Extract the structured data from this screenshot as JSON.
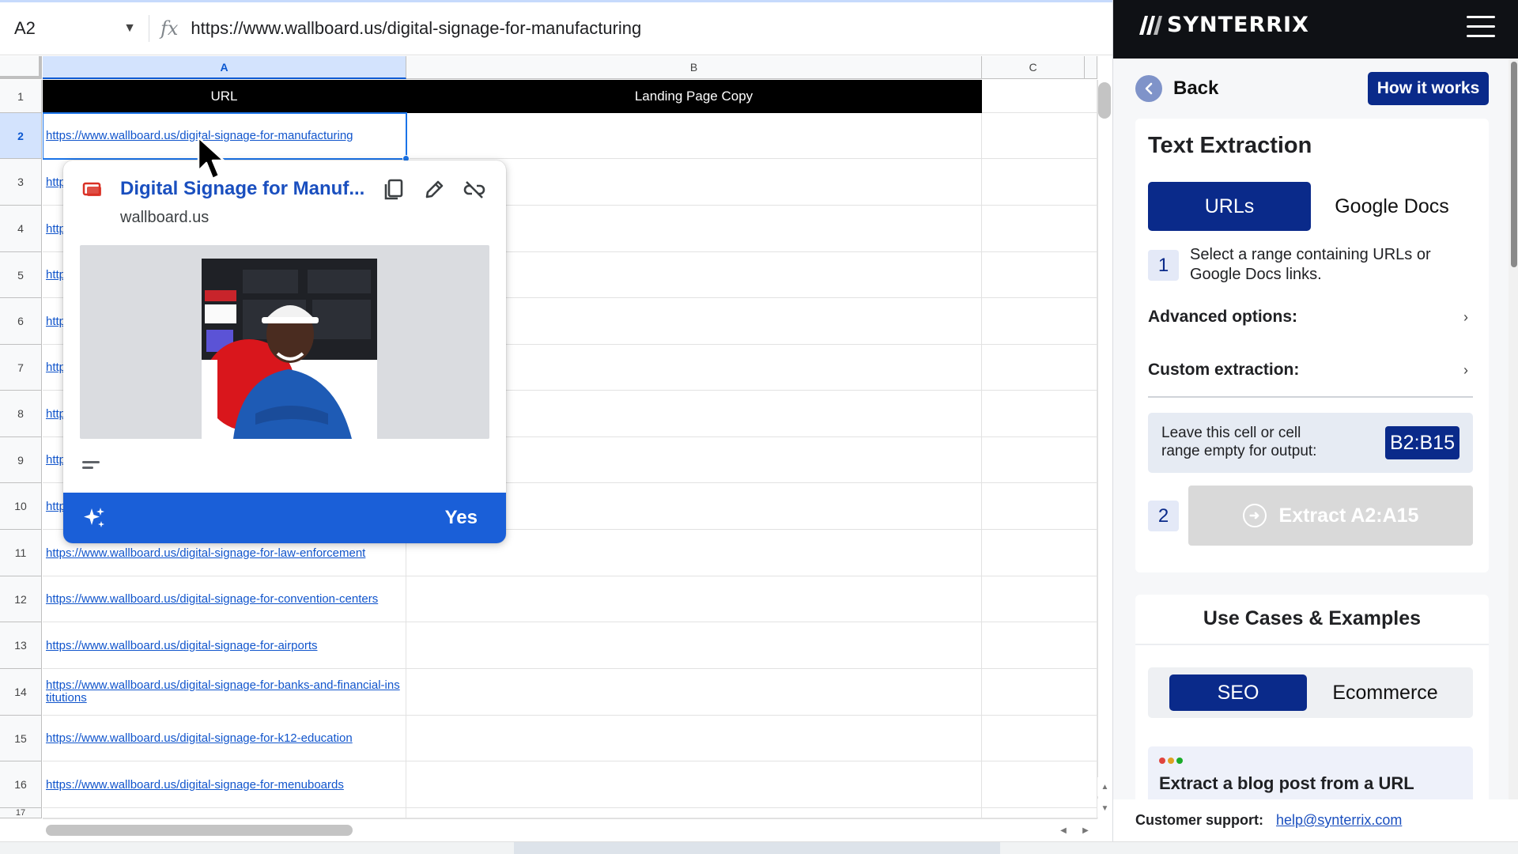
{
  "sheet": {
    "name_box": "A2",
    "formula_value": "https://www.wallboard.us/digital-signage-for-manufacturing",
    "columns": [
      "A",
      "B",
      "C"
    ],
    "rows": [
      "1",
      "2",
      "3",
      "4",
      "5",
      "6",
      "7",
      "8",
      "9",
      "10",
      "11",
      "12",
      "13",
      "14",
      "15",
      "16",
      "17"
    ],
    "header_row": {
      "a": "URL",
      "b": "Landing Page Copy"
    },
    "cells": {
      "r2": "https://www.wallboard.us/digital-signage-for-manufacturing",
      "r3": "http",
      "r4": "http",
      "r5": "http",
      "r6": "http",
      "r7": "http",
      "r8": "http",
      "r9": "http",
      "r10": "http",
      "r11": "https://www.wallboard.us/digital-signage-for-law-enforcement",
      "r12": "https://www.wallboard.us/digital-signage-for-convention-centers",
      "r13": "https://www.wallboard.us/digital-signage-for-airports",
      "r14": "https://www.wallboard.us/digital-signage-for-banks-and-financial-institutions",
      "r15": "https://www.wallboard.us/digital-signage-for-k12-education",
      "r16": "https://www.wallboard.us/digital-signage-for-menuboards"
    }
  },
  "popup": {
    "title": "Digital Signage for Manuf...",
    "domain": "wallboard.us",
    "footer_action": "Yes",
    "icons": [
      "favicon-icon",
      "copy-icon",
      "edit-icon",
      "unlink-icon",
      "sparkle-icon",
      "lines-icon"
    ]
  },
  "panel": {
    "brand": "SYNTERRIX",
    "back_label": "Back",
    "how_it_works": "How it works",
    "section_title": "Text Extraction",
    "tabs": {
      "active": "URLs",
      "inactive": "Google Docs"
    },
    "step1_number": "1",
    "step1_text": "Select a range containing URLs or Google Docs links.",
    "advanced_options": "Advanced options:",
    "custom_extraction": "Custom extraction:",
    "output_text": "Leave this cell or cell range empty for output:",
    "output_range": "B2:B15",
    "step2_number": "2",
    "extract_button": "Extract A2:A15",
    "use_cases_title": "Use Cases & Examples",
    "use_case_tabs": {
      "active": "SEO",
      "inactive": "Ecommerce"
    },
    "example_title": "Extract a blog post from a URL",
    "support_label": "Customer support:",
    "support_email": "help@synterrix.com"
  },
  "colors": {
    "accent": "#0a2a8a",
    "link": "#1155cc",
    "selection": "#1a73e8",
    "popup_footer": "#1a5fd8",
    "header_dark": "#0f1115"
  }
}
